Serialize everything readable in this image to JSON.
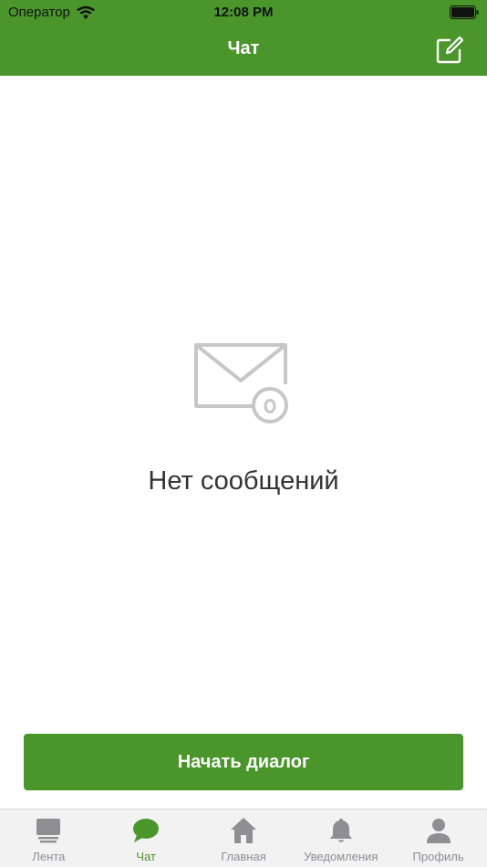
{
  "status_bar": {
    "carrier": "Оператор",
    "time": "12:08 PM"
  },
  "nav": {
    "title": "Чат"
  },
  "empty_state": {
    "message": "Нет сообщений"
  },
  "actions": {
    "start_dialog": "Начать диалог"
  },
  "tabbar": {
    "items": [
      {
        "label": "Лента",
        "icon": "feed-icon",
        "active": false
      },
      {
        "label": "Чат",
        "icon": "chat-bubble-icon",
        "active": true
      },
      {
        "label": "Главная",
        "icon": "home-icon",
        "active": false
      },
      {
        "label": "Уведомления",
        "icon": "bell-icon",
        "active": false
      },
      {
        "label": "Профиль",
        "icon": "person-icon",
        "active": false
      }
    ]
  },
  "colors": {
    "accent": "#4a962b",
    "inactive": "#8e8e93",
    "icon_gray": "#c7c7c7"
  }
}
